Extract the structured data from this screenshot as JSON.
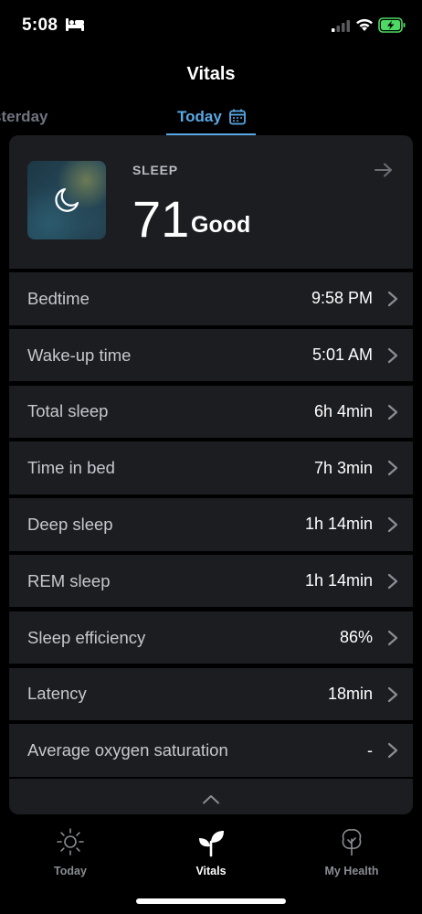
{
  "status_bar": {
    "time": "5:08"
  },
  "header": {
    "title": "Vitals"
  },
  "tabs": {
    "previous": "sterday",
    "current": "Today"
  },
  "sleep": {
    "label": "SLEEP",
    "score": "71",
    "quality": "Good"
  },
  "rows": [
    {
      "label": "Bedtime",
      "value": "9:58 PM"
    },
    {
      "label": "Wake-up time",
      "value": "5:01 AM"
    },
    {
      "label": "Total sleep",
      "value": "6h 4min"
    },
    {
      "label": "Time in bed",
      "value": "7h 3min"
    },
    {
      "label": "Deep sleep",
      "value": "1h 14min"
    },
    {
      "label": "REM sleep",
      "value": "1h 14min"
    },
    {
      "label": "Sleep efficiency",
      "value": "86%"
    },
    {
      "label": "Latency",
      "value": "18min"
    },
    {
      "label": "Average oxygen saturation",
      "value": "-"
    }
  ],
  "bottom_nav": {
    "today": "Today",
    "vitals": "Vitals",
    "health": "My Health"
  },
  "colors": {
    "accent": "#5aa8e6",
    "card": "#1c1d21",
    "battery": "#4cd964"
  }
}
